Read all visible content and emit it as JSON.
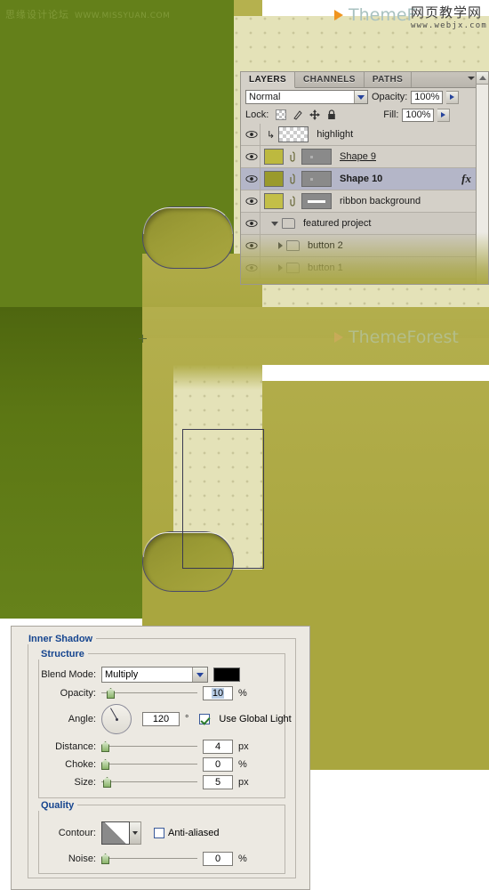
{
  "watermarks": {
    "forum_name": "思缘设计论坛",
    "forum_url": "WWW.MISSYUAN.COM",
    "site_cn": "网页教学网",
    "site_url": "www.webjx.com",
    "theme_logo_top": "ThemeF",
    "theme_logo_mid": "ThemeForest"
  },
  "layers_panel": {
    "tabs": [
      {
        "label": "LAYERS",
        "active": true
      },
      {
        "label": "CHANNELS",
        "active": false
      },
      {
        "label": "PATHS",
        "active": false
      }
    ],
    "menu_icon": "panel-menu-icon",
    "blend_mode": "Normal",
    "opacity_label": "Opacity:",
    "opacity_value": "100%",
    "lock_label": "Lock:",
    "lock_icons": [
      "lock-transparency-icon",
      "lock-image-pixels-icon",
      "lock-position-icon",
      "lock-all-icon"
    ],
    "fill_label": "Fill:",
    "fill_value": "100%",
    "rows": [
      {
        "name": "highlight",
        "visible": true,
        "clipped": true,
        "selected": false,
        "type": "pixel",
        "bold": false,
        "underline": false,
        "fx": false
      },
      {
        "name": "Shape 9",
        "visible": true,
        "clipped": false,
        "selected": false,
        "type": "shape",
        "bold": false,
        "underline": true,
        "fx": false
      },
      {
        "name": "Shape 10",
        "visible": true,
        "clipped": false,
        "selected": true,
        "type": "shape",
        "bold": true,
        "underline": false,
        "fx": true
      },
      {
        "name": "ribbon background",
        "visible": true,
        "clipped": false,
        "selected": false,
        "type": "shape",
        "bold": false,
        "underline": false,
        "fx": false
      },
      {
        "name": "featured project",
        "visible": true,
        "clipped": false,
        "selected": false,
        "type": "group-open",
        "bold": false,
        "underline": false,
        "fx": false
      },
      {
        "name": "button 2",
        "visible": true,
        "clipped": false,
        "selected": false,
        "type": "group",
        "bold": false,
        "underline": false,
        "fx": false
      },
      {
        "name": "button 1",
        "visible": true,
        "clipped": false,
        "selected": false,
        "type": "group",
        "bold": false,
        "underline": false,
        "fx": false
      }
    ]
  },
  "inner_shadow_dialog": {
    "title": "Inner Shadow",
    "structure_title": "Structure",
    "quality_title": "Quality",
    "blend_mode_label": "Blend Mode:",
    "blend_mode_value": "Multiply",
    "shadow_color": "#000000",
    "opacity_label": "Opacity:",
    "opacity_value": "10",
    "opacity_unit": "%",
    "angle_label": "Angle:",
    "angle_value": "120",
    "angle_unit": "°",
    "use_global_light_label": "Use Global Light",
    "use_global_light_checked": true,
    "distance_label": "Distance:",
    "distance_value": "4",
    "distance_unit": "px",
    "choke_label": "Choke:",
    "choke_value": "0",
    "choke_unit": "%",
    "size_label": "Size:",
    "size_value": "5",
    "size_unit": "px",
    "contour_label": "Contour:",
    "anti_aliased_label": "Anti-aliased",
    "anti_aliased_checked": false,
    "noise_label": "Noise:",
    "noise_value": "0",
    "noise_unit": "%"
  },
  "colors": {
    "dark_green": "#64801a",
    "olive": "#a9a63f",
    "pattern_cream": "#e4e2b8",
    "panel_gray": "#d4d0c8",
    "dialog_gray": "#ece9e2",
    "legend_blue": "#16458f"
  }
}
